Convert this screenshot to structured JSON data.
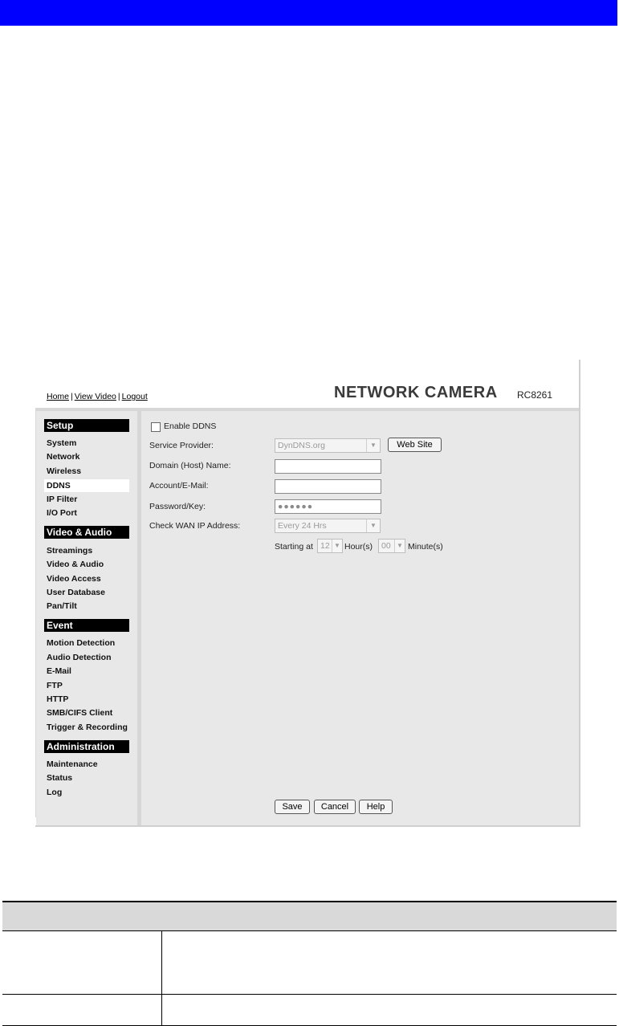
{
  "header": {
    "links": [
      "Home",
      "View Video",
      "Logout"
    ],
    "brand": "NETWORK CAMERA",
    "model": "RC8261"
  },
  "sidebar": {
    "sections": [
      {
        "title": "Setup",
        "items": [
          "System",
          "Network",
          "Wireless",
          "DDNS",
          "IP Filter",
          "I/O Port"
        ]
      },
      {
        "title": "Video & Audio",
        "items": [
          "Streamings",
          "Video & Audio",
          "Video Access",
          "User Database",
          "Pan/Tilt"
        ]
      },
      {
        "title": "Event",
        "items": [
          "Motion Detection",
          "Audio Detection",
          "E-Mail",
          "FTP",
          "HTTP",
          "SMB/CIFS Client",
          "Trigger & Recording"
        ]
      },
      {
        "title": "Administration",
        "items": [
          "Maintenance",
          "Status",
          "Log"
        ]
      }
    ],
    "active_item": "DDNS"
  },
  "form": {
    "enable_label": "Enable DDNS",
    "enable_checked": false,
    "service_provider_label": "Service Provider:",
    "service_provider_value": "DynDNS.org",
    "website_button": "Web Site",
    "domain_label": "Domain (Host) Name:",
    "domain_value": "",
    "account_label": "Account/E-Mail:",
    "account_value": "",
    "password_label": "Password/Key:",
    "password_value": "●●●●●●",
    "check_wan_label": "Check WAN IP Address:",
    "check_wan_value": "Every 24 Hrs",
    "starting_at_label": "Starting at",
    "hour_value": "12",
    "hour_label": "Hour(s)",
    "minute_value": "00",
    "minute_label": "Minute(s)"
  },
  "buttons": {
    "save": "Save",
    "cancel": "Cancel",
    "help": "Help"
  },
  "colors": {
    "top_bar": "#0000ff",
    "section_header": "#000000",
    "panel_bg": "#e8e8e8"
  }
}
